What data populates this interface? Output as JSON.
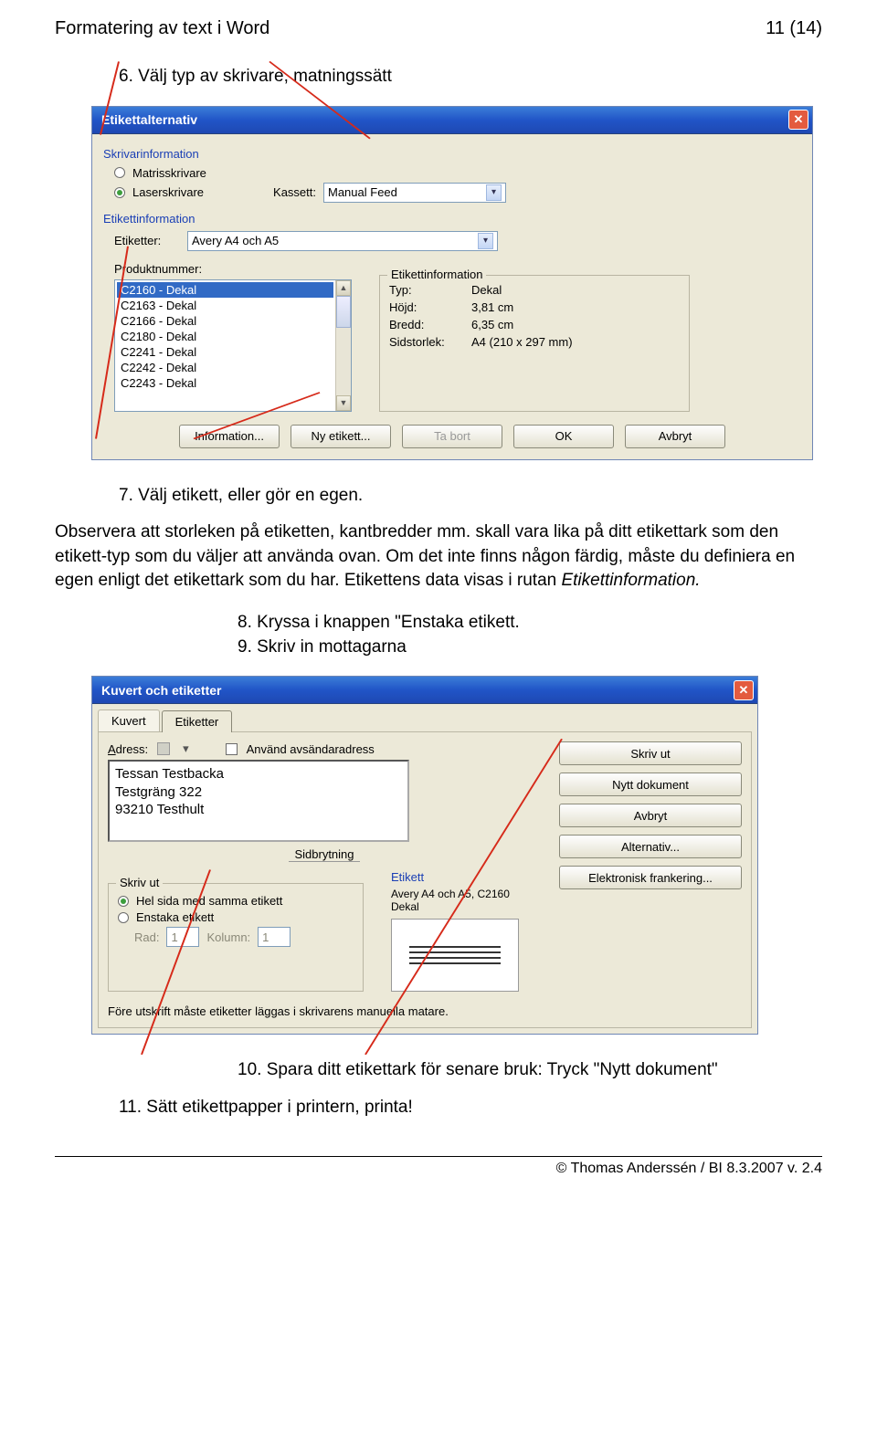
{
  "header": {
    "left": "Formatering av text i Word",
    "right": "11 (14)"
  },
  "step6": "6. Välj typ av skrivare, matningssätt",
  "dlg1": {
    "title": "Etikettalternativ",
    "sec_printer": "Skrivarinformation",
    "radio_matrix": "Matrisskrivare",
    "radio_laser": "Laserskrivare",
    "tray_label": "Kassett:",
    "tray_value": "Manual Feed",
    "sec_labelinfo": "Etikettinformation",
    "labels_label": "Etiketter:",
    "labels_value": "Avery A4 och A5",
    "prodnum_label": "Produktnummer:",
    "list": [
      "C2160 - Dekal",
      "C2163 - Dekal",
      "C2166 - Dekal",
      "C2180 - Dekal",
      "C2241 - Dekal",
      "C2242 - Dekal",
      "C2243 - Dekal"
    ],
    "infobox_title": "Etikettinformation",
    "info_type_l": "Typ:",
    "info_type_v": "Dekal",
    "info_h_l": "Höjd:",
    "info_h_v": "3,81 cm",
    "info_w_l": "Bredd:",
    "info_w_v": "6,35 cm",
    "info_page_l": "Sidstorlek:",
    "info_page_v": "A4 (210 x 297 mm)",
    "btn_info": "Information...",
    "btn_new": "Ny etikett...",
    "btn_del": "Ta bort",
    "btn_ok": "OK",
    "btn_cancel": "Avbryt"
  },
  "step7": "7. Välj etikett, eller gör en egen.",
  "para1": "Observera att storleken på etiketten, kantbredder mm. skall vara lika på ditt etikettark som den etikett-typ som du väljer att använda ovan. Om det inte finns någon färdig, måste du definiera en egen enligt det etikettark som du har. Etikettens data visas i rutan ",
  "para1_em": "Etikettinformation.",
  "step8": "8. Kryssa i knappen \"Enstaka etikett.",
  "step9": "9. Skriv in mottagarna",
  "dlg2": {
    "title": "Kuvert och etiketter",
    "tab1": "Kuvert",
    "tab2": "Etiketter",
    "addr_label_pre": "A",
    "addr_label_rest": "dress:",
    "use_sender": "Använd avsändaradress",
    "addr_lines": [
      "Tessan Testbacka",
      "Testgräng 322",
      "93210 Testhult"
    ],
    "sidb": "Sidbrytning",
    "print_section": "Skriv ut",
    "r_full": "Hel sida med samma etikett",
    "r_single": "Enstaka etikett",
    "rad_l": "Rad:",
    "rad_v": "1",
    "kol_l": "Kolumn:",
    "kol_v": "1",
    "btn_print": "Skriv ut",
    "btn_newdoc": "Nytt dokument",
    "btn_cancel": "Avbryt",
    "btn_opts": "Alternativ...",
    "btn_efrank": "Elektronisk frankering...",
    "etikett_label": "Etikett",
    "etikett_info1": "Avery A4 och A5, C2160",
    "etikett_info2": "Dekal",
    "bottom_note": "Före utskrift måste etiketter läggas i skrivarens manuella matare."
  },
  "step10": "10. Spara ditt etikettark för senare bruk: Tryck \"Nytt dokument\"",
  "step11": "11. Sätt etikettpapper i printern, printa!",
  "footer": "© Thomas Anderssén / BI 8.3.2007 v. 2.4"
}
